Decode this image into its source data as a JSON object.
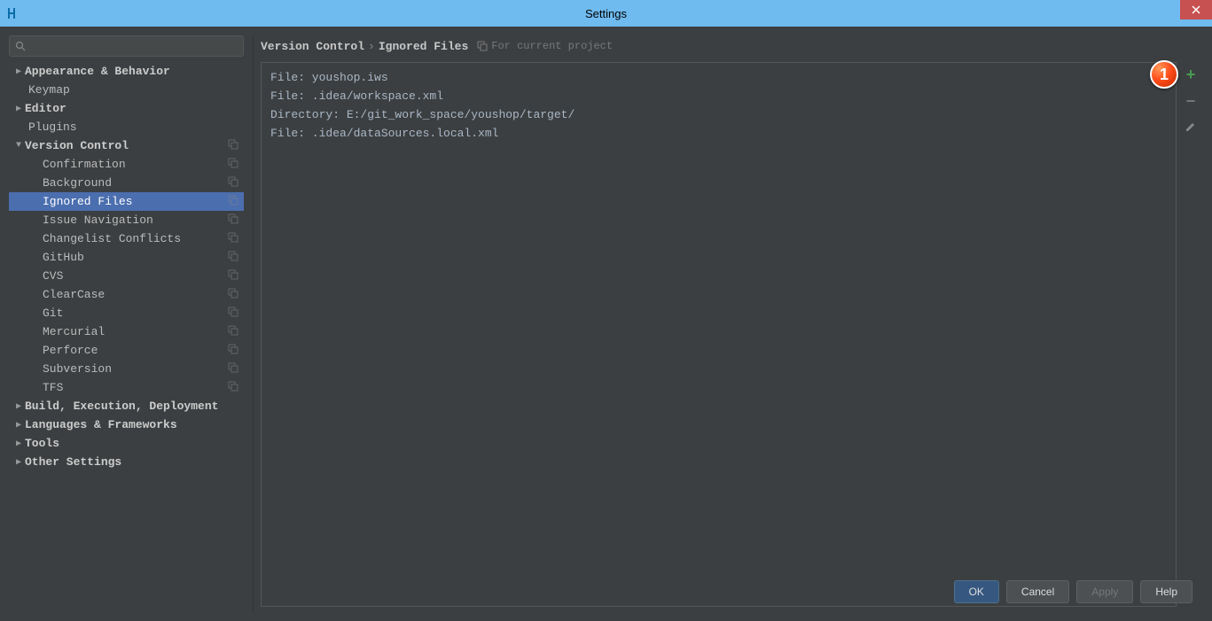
{
  "window": {
    "title": "Settings"
  },
  "search": {
    "placeholder": ""
  },
  "sidebar": {
    "items": [
      {
        "label": "Appearance & Behavior",
        "bold": true,
        "arrow": "right",
        "indent": 0,
        "copy": false
      },
      {
        "label": "Keymap",
        "bold": false,
        "arrow": "",
        "indent": 1,
        "copy": false
      },
      {
        "label": "Editor",
        "bold": true,
        "arrow": "right",
        "indent": 0,
        "copy": false
      },
      {
        "label": "Plugins",
        "bold": false,
        "arrow": "",
        "indent": 1,
        "copy": false
      },
      {
        "label": "Version Control",
        "bold": true,
        "arrow": "down",
        "indent": 0,
        "copy": true
      },
      {
        "label": "Confirmation",
        "bold": false,
        "arrow": "",
        "indent": 2,
        "copy": true
      },
      {
        "label": "Background",
        "bold": false,
        "arrow": "",
        "indent": 2,
        "copy": true
      },
      {
        "label": "Ignored Files",
        "bold": false,
        "arrow": "",
        "indent": 2,
        "copy": true,
        "selected": true
      },
      {
        "label": "Issue Navigation",
        "bold": false,
        "arrow": "",
        "indent": 2,
        "copy": true
      },
      {
        "label": "Changelist Conflicts",
        "bold": false,
        "arrow": "",
        "indent": 2,
        "copy": true
      },
      {
        "label": "GitHub",
        "bold": false,
        "arrow": "",
        "indent": 2,
        "copy": true
      },
      {
        "label": "CVS",
        "bold": false,
        "arrow": "",
        "indent": 2,
        "copy": true
      },
      {
        "label": "ClearCase",
        "bold": false,
        "arrow": "",
        "indent": 2,
        "copy": true
      },
      {
        "label": "Git",
        "bold": false,
        "arrow": "",
        "indent": 2,
        "copy": true
      },
      {
        "label": "Mercurial",
        "bold": false,
        "arrow": "",
        "indent": 2,
        "copy": true
      },
      {
        "label": "Perforce",
        "bold": false,
        "arrow": "",
        "indent": 2,
        "copy": true
      },
      {
        "label": "Subversion",
        "bold": false,
        "arrow": "",
        "indent": 2,
        "copy": true
      },
      {
        "label": "TFS",
        "bold": false,
        "arrow": "",
        "indent": 2,
        "copy": true
      },
      {
        "label": "Build, Execution, Deployment",
        "bold": true,
        "arrow": "right",
        "indent": 0,
        "copy": false
      },
      {
        "label": "Languages & Frameworks",
        "bold": true,
        "arrow": "right",
        "indent": 0,
        "copy": false
      },
      {
        "label": "Tools",
        "bold": true,
        "arrow": "right",
        "indent": 0,
        "copy": false
      },
      {
        "label": "Other Settings",
        "bold": true,
        "arrow": "right",
        "indent": 0,
        "copy": false
      }
    ]
  },
  "breadcrumb": {
    "root": "Version Control",
    "leaf": "Ignored Files",
    "hint": "For current project"
  },
  "ignored_list": [
    "File: youshop.iws",
    "File: .idea/workspace.xml",
    "Directory: E:/git_work_space/youshop/target/",
    "File: .idea/dataSources.local.xml"
  ],
  "callout": {
    "number": "1"
  },
  "buttons": {
    "ok": "OK",
    "cancel": "Cancel",
    "apply": "Apply",
    "help": "Help"
  }
}
